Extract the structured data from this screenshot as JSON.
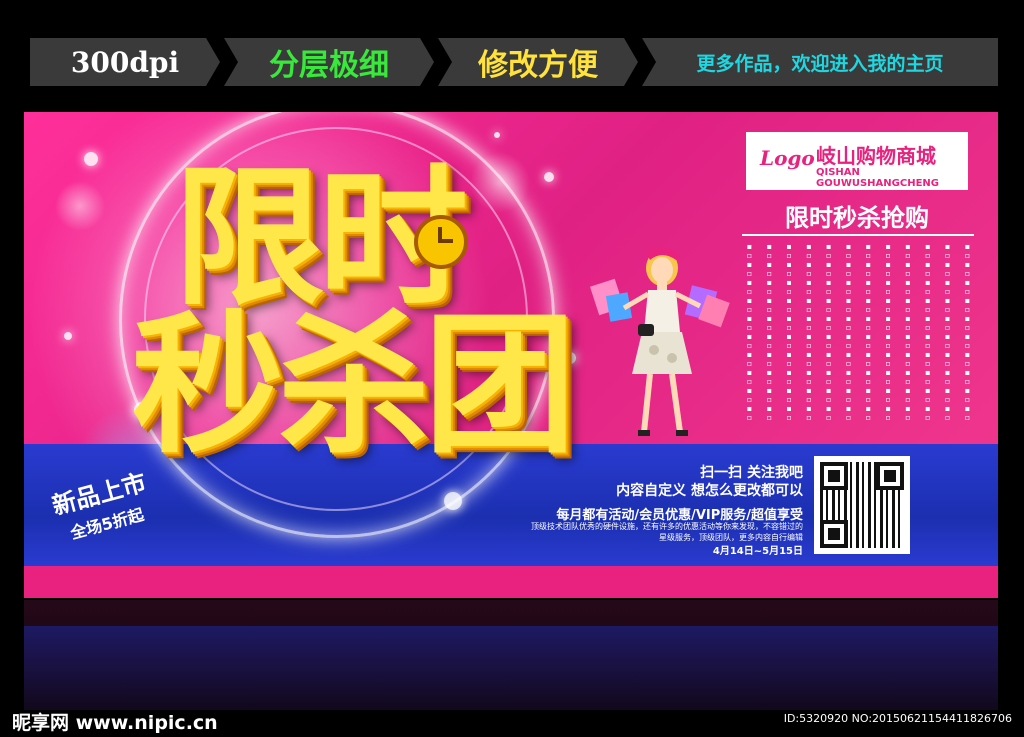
{
  "ribbon": {
    "items": [
      {
        "label": "300dpi",
        "color": "#ffffff"
      },
      {
        "label": "分层极细",
        "color": "#38e83a"
      },
      {
        "label": "修改方便",
        "color": "#ffe23b"
      },
      {
        "label": "更多作品，欢迎进入我的主页",
        "color": "#1fd7e0"
      }
    ]
  },
  "poster": {
    "title_line1": "限时",
    "title_line2": "秒杀团",
    "stamp_line1": "新品上市",
    "stamp_line2": "全场5折起",
    "logo_mark": "Logo",
    "store_name": "岐山购物商城",
    "store_pinyin": "QISHAN GOUWUSHANGCHENG",
    "slogan": "限时秒杀抢购",
    "info_line1": "扫一扫  关注我吧",
    "info_line2": "内容自定义  想怎么更改都可以",
    "info_line3": "每月都有活动/会员优惠/VIP服务/超值享受",
    "info_line4": "顶级技术团队优秀的硬件设施，还有许多的优惠活动等你来发现，不容错过的",
    "info_line5": "星级服务，顶级团队，更多内容自行编辑",
    "date_range": "4月14日~5月15日",
    "colors": {
      "pink": "#e8227e",
      "blue": "#1b2fb0",
      "yellow": "#ffe74a"
    }
  },
  "footer": {
    "watermark": "昵享网 www.nipic.cn",
    "id_line": "ID:5320920 NO:20150621154411826706"
  }
}
